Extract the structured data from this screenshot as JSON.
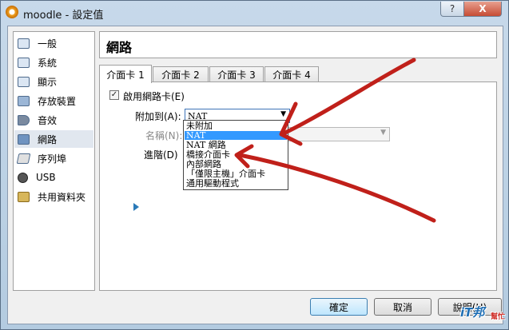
{
  "window": {
    "title": "moodle - 設定值",
    "help_label": "?",
    "close_label": "X"
  },
  "sidebar": {
    "items": [
      {
        "label": "一般",
        "icon": "general-icon"
      },
      {
        "label": "系統",
        "icon": "system-icon"
      },
      {
        "label": "顯示",
        "icon": "display-icon"
      },
      {
        "label": "存放裝置",
        "icon": "storage-icon"
      },
      {
        "label": "音效",
        "icon": "audio-icon"
      },
      {
        "label": "網路",
        "icon": "network-icon",
        "selected": true
      },
      {
        "label": "序列埠",
        "icon": "serial-port-icon"
      },
      {
        "label": "USB",
        "icon": "usb-icon"
      },
      {
        "label": "共用資料夾",
        "icon": "shared-folder-icon"
      }
    ]
  },
  "page_title": "網路",
  "tabs": [
    {
      "label": "介面卡 1",
      "active": true
    },
    {
      "label": "介面卡 2"
    },
    {
      "label": "介面卡 3"
    },
    {
      "label": "介面卡 4"
    }
  ],
  "adapter": {
    "enable_label": "啟用網路卡(E)",
    "enabled": true,
    "attached_to_label": "附加到(A):",
    "attached_to_value": "NAT",
    "name_label": "名稱(N):",
    "advanced_label": "進階(D)"
  },
  "dropdown": {
    "options": [
      {
        "label": "未附加"
      },
      {
        "label": "NAT",
        "selected": true
      },
      {
        "label": "NAT 網路"
      },
      {
        "label": "橋接介面卡"
      },
      {
        "label": "內部網路"
      },
      {
        "label": "「僅限主機」介面卡"
      },
      {
        "label": "通用驅動程式"
      }
    ]
  },
  "buttons": {
    "ok": "確定",
    "cancel": "取消",
    "help": "說明(H)"
  },
  "watermark": {
    "text": "iT邦",
    "sub": "幫忙"
  },
  "colors": {
    "annotation_arrow": "#c0201a",
    "selection": "#3399ff"
  }
}
